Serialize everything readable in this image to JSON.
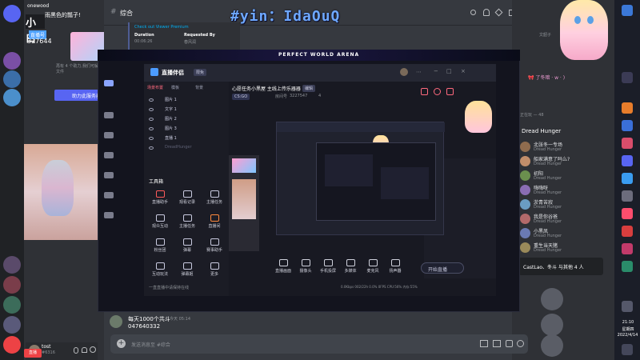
{
  "discord": {
    "server_name": "onewood",
    "channel_name": "综合",
    "header_user": "雨黑色的瓢子!",
    "profile_views": "327644",
    "signup_button": "助力此服务器",
    "promo_text": "再有 4 个助力,我们可解锁更多上传文件",
    "user_tag": "tost",
    "user_subtag": "#6316",
    "hd_badge": "直播号",
    "chat_placeholder": "发送消息至 #综合",
    "message_text": "每天1000个共斗",
    "message_meta": "今天 05:14",
    "message_code": "047640332",
    "live_card": {
      "link": "Check out Viewer Premium",
      "duration_label": "Duration",
      "duration_value": "00:06:26",
      "requested_label": "Requested By",
      "requested_value": "春风润"
    }
  },
  "overlay_window": {
    "banner": "PERFECT WORLD ARENA",
    "watermark": "#yin：IdaOuQ"
  },
  "bili": {
    "app_title": "直播伴侣",
    "app_badge": "限免",
    "stream_title": "心愿任务小黑屋 主线上传乐器器",
    "edit_tag": "编辑",
    "area_tag": "CS:GO",
    "id_tag": "房间号",
    "room_id": "3227547",
    "fans_count": "4",
    "layer_tabs": [
      "场景布置",
      "模板",
      "背景"
    ],
    "layers": [
      "图片 1",
      "文字 1",
      "图片 2",
      "图片 3",
      "直播 1",
      "DreadHunger"
    ],
    "tools_label": "工具箱",
    "tools": [
      "直播助手",
      "观看记录",
      "主播任务",
      "观众互动",
      "主播任务",
      "直播间",
      "粉丝团",
      "弹幕",
      "赛事助手",
      "互动玩法",
      "弹幕姬",
      "更多"
    ],
    "bottom_tools": [
      "直播画面",
      "摄像头",
      "手机投屏",
      "多媒体",
      "麦克风",
      "扬声器"
    ],
    "start_button": "开始直播",
    "stats": "0.0Kbps 002/22h 0.0% 0FPS CPU:56% 内存:55%",
    "footer_label": "一直直播中请保持在线"
  },
  "members": {
    "group_label": "正在玩 — 48",
    "section_title": "Dread Hunger",
    "rows": [
      {
        "name": "北张冬一专场",
        "game": "Dread Hunger"
      },
      {
        "name": "船家满意了吗么?",
        "game": "Dread Hunger"
      },
      {
        "name": "初阳",
        "game": "Dread Hunger"
      },
      {
        "name": "嗨嗨呀",
        "game": "Dread Hunger"
      },
      {
        "name": "淤青苦寂",
        "game": "Dread Hunger"
      },
      {
        "name": "我是你谷爸",
        "game": "Dread Hunger"
      },
      {
        "name": "小黑凤",
        "game": "Dread Hunger"
      },
      {
        "name": "重生当天猪",
        "game": "Dread Hunger"
      }
    ],
    "notice": "CastLao、冬斗 与其他 4 人",
    "top_label": "文韶子",
    "tag_label": "🎀 了冬暗 · w · )"
  },
  "taskbar": {
    "time": "21:10",
    "weekday": "星期四",
    "date": "2022/4/14"
  }
}
